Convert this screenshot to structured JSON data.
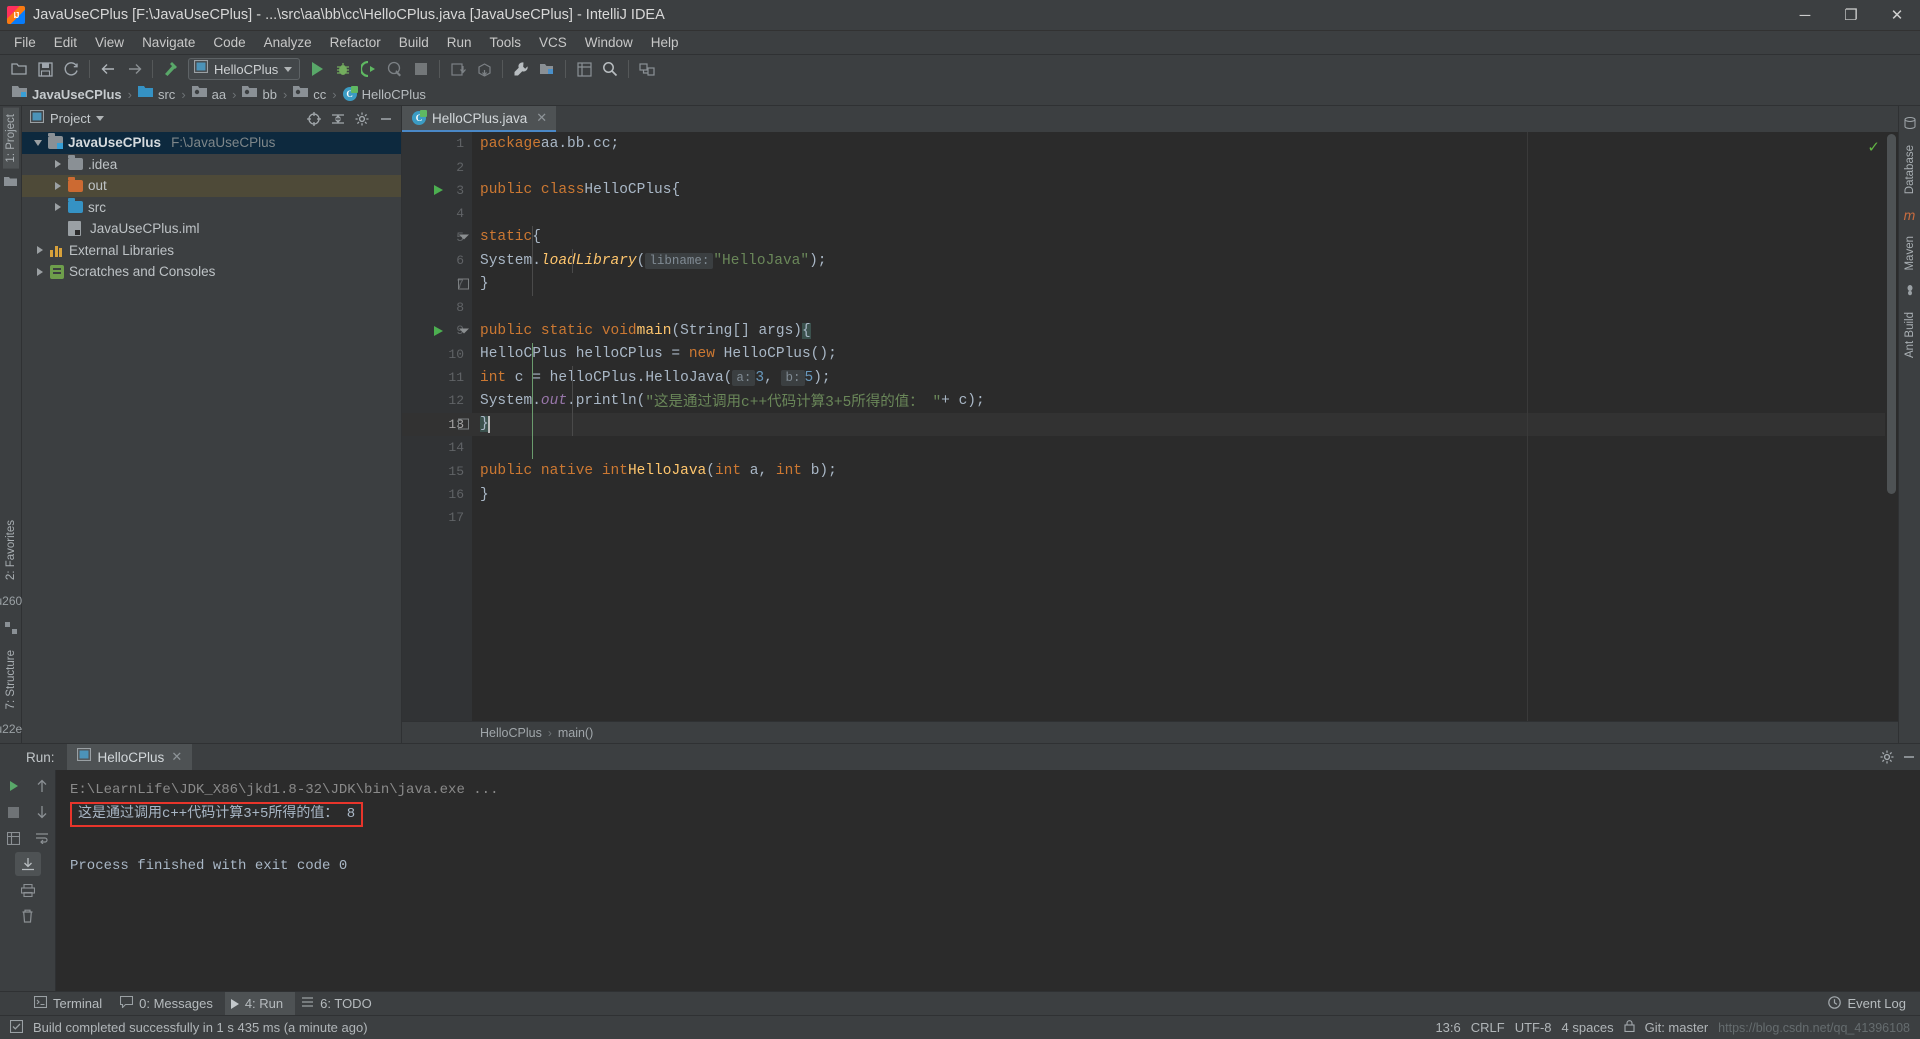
{
  "window": {
    "title": "JavaUseCPlus [F:\\JavaUseCPlus] - ...\\src\\aa\\bb\\cc\\HelloCPlus.java [JavaUseCPlus] - IntelliJ IDEA",
    "minimize_label": "─",
    "maximize_label": "❐",
    "close_label": "✕",
    "logo_icon": "intellij-idea-logo"
  },
  "menubar": {
    "items": [
      "File",
      "Edit",
      "View",
      "Navigate",
      "Code",
      "Analyze",
      "Refactor",
      "Build",
      "Run",
      "Tools",
      "VCS",
      "Window",
      "Help"
    ]
  },
  "toolbar": {
    "buttons": [
      {
        "name": "open-folder-icon",
        "glyph": "📂"
      },
      {
        "name": "save-all-icon",
        "glyph": "💾"
      },
      {
        "name": "sync-refresh-icon",
        "glyph": "↻"
      },
      {
        "name": "back-arrow-icon",
        "glyph": "←"
      },
      {
        "name": "forward-arrow-icon",
        "glyph": "→"
      },
      {
        "name": "compile-hammer-icon",
        "glyph": "⚒"
      }
    ],
    "run_config": {
      "label": "HelloCPlus",
      "icon": "run-configuration-icon"
    },
    "run_button": "run-icon",
    "debug_button": "debug-icon",
    "run_coverage_button": "run-with-coverage-icon",
    "profile_button": "profile-icon",
    "stop_button": "stop-icon",
    "right_buttons": [
      {
        "name": "update-project-icon",
        "glyph": "⭳"
      },
      {
        "name": "commit-icon",
        "glyph": "⭱"
      },
      {
        "name": "settings-wrench-icon",
        "glyph": "🔧"
      },
      {
        "name": "project-structure-icon",
        "glyph": "▣"
      },
      {
        "name": "sdk-manager-icon",
        "glyph": "▤"
      },
      {
        "name": "search-everywhere-icon",
        "glyph": "⚲"
      },
      {
        "name": "device-manager-icon",
        "glyph": "⌗"
      }
    ]
  },
  "breadcrumb": {
    "items": [
      {
        "label": "JavaUseCPlus",
        "icon": "project-module-icon"
      },
      {
        "label": "src",
        "icon": "source-folder-icon"
      },
      {
        "label": "aa",
        "icon": "package-icon"
      },
      {
        "label": "bb",
        "icon": "package-icon"
      },
      {
        "label": "cc",
        "icon": "package-icon"
      },
      {
        "label": "HelloCPlus",
        "icon": "java-class-icon"
      }
    ],
    "separator": "›"
  },
  "left_rail": {
    "tabs": [
      {
        "label": "1: Project",
        "active": true
      },
      {
        "label": "2: Favorites",
        "active": false
      },
      {
        "label": "7: Structure",
        "active": false
      }
    ],
    "icons": [
      "folder-icon",
      "bookmark-star-icon",
      "structure-icon"
    ]
  },
  "right_rail": {
    "tabs": [
      "Database",
      "Maven",
      "Ant Build"
    ]
  },
  "project_panel": {
    "title": "Project",
    "title_caret": "▾",
    "header_icons": [
      {
        "name": "scroll-from-source-icon",
        "glyph": "⊕"
      },
      {
        "name": "collapse-all-icon",
        "glyph": "⤓"
      },
      {
        "name": "settings-gear-icon",
        "glyph": "⚙"
      },
      {
        "name": "hide-panel-icon",
        "glyph": "─"
      }
    ],
    "tree": [
      {
        "label": "JavaUseCPlus",
        "path": "F:\\JavaUseCPlus",
        "icon": "project-module-icon",
        "indent": 0,
        "arrow": "open",
        "selected": true,
        "bold": true
      },
      {
        "label": ".idea",
        "path": "",
        "icon": "folder-grey-icon",
        "indent": 1,
        "arrow": "closed",
        "selected": false,
        "bold": false
      },
      {
        "label": "out",
        "path": "",
        "icon": "folder-orange-icon",
        "indent": 1,
        "arrow": "closed",
        "selected": false,
        "highlight": true,
        "bold": false
      },
      {
        "label": "src",
        "path": "",
        "icon": "source-folder-icon",
        "indent": 1,
        "arrow": "closed",
        "selected": false,
        "bold": false
      },
      {
        "label": "JavaUseCPlus.iml",
        "path": "",
        "icon": "iml-file-icon",
        "indent": 2,
        "arrow": "none",
        "selected": false,
        "bold": false
      },
      {
        "label": "External Libraries",
        "path": "",
        "icon": "external-libraries-icon",
        "indent": 0,
        "arrow": "closed",
        "selected": false,
        "bold": false
      },
      {
        "label": "Scratches and Consoles",
        "path": "",
        "icon": "scratches-icon",
        "indent": 0,
        "arrow": "closed",
        "selected": false,
        "bold": false
      }
    ]
  },
  "editor": {
    "tab": {
      "filename": "HelloCPlus.java",
      "icon": "java-class-icon",
      "close": "✕"
    },
    "inspection_status": "✓",
    "lines": [
      {
        "n": 1,
        "run_marker": false,
        "fold": "none"
      },
      {
        "n": 2,
        "run_marker": false,
        "fold": "none"
      },
      {
        "n": 3,
        "run_marker": true,
        "fold": "none"
      },
      {
        "n": 4,
        "run_marker": false,
        "fold": "none"
      },
      {
        "n": 5,
        "run_marker": false,
        "fold": "start"
      },
      {
        "n": 6,
        "run_marker": false,
        "fold": "none"
      },
      {
        "n": 7,
        "run_marker": false,
        "fold": "end"
      },
      {
        "n": 8,
        "run_marker": false,
        "fold": "none"
      },
      {
        "n": 9,
        "run_marker": true,
        "fold": "start"
      },
      {
        "n": 10,
        "run_marker": false,
        "fold": "none"
      },
      {
        "n": 11,
        "run_marker": false,
        "fold": "none"
      },
      {
        "n": 12,
        "run_marker": false,
        "fold": "none"
      },
      {
        "n": 13,
        "run_marker": false,
        "fold": "end",
        "current": true
      },
      {
        "n": 14,
        "run_marker": false,
        "fold": "none"
      },
      {
        "n": 15,
        "run_marker": false,
        "fold": "none"
      },
      {
        "n": 16,
        "run_marker": false,
        "fold": "none"
      },
      {
        "n": 17,
        "run_marker": false,
        "fold": "none"
      }
    ],
    "source_text": [
      "package aa.bb.cc;",
      "",
      "public class HelloCPlus {",
      "",
      "    static {",
      "        System.loadLibrary( libname: \"HelloJava\");",
      "    }",
      "",
      "    public static void main(String[] args){",
      "        HelloCPlus helloCPlus = new HelloCPlus();",
      "        int c = helloCPlus.HelloJava( a: 3,  b: 5);",
      "        System.out.println(\"这是通过调用c++代码计算3+5所得的值： \"+ c);",
      "    }",
      "",
      "    public native int HelloJava(int a, int b);",
      "}",
      ""
    ],
    "param_hints": [
      "libname:",
      "a:",
      "b:"
    ],
    "string_literals": [
      "\"HelloJava\"",
      "\"这是通过调用c++代码计算3+5所得的值： \""
    ],
    "breadcrumb_bottom": {
      "class": "HelloCPlus",
      "method": "main()",
      "separator": "›"
    }
  },
  "run_window": {
    "label": "Run:",
    "tab": {
      "name": "HelloCPlus",
      "icon": "run-configuration-icon",
      "close": "✕"
    },
    "header_icons": [
      {
        "name": "settings-gear-icon",
        "glyph": "⚙"
      },
      {
        "name": "hide-panel-icon",
        "glyph": "─"
      }
    ],
    "side_buttons": [
      {
        "name": "rerun-button",
        "glyph": "▶"
      },
      {
        "name": "scroll-up-button",
        "glyph": "↑"
      },
      {
        "name": "stop-button",
        "glyph": "■"
      },
      {
        "name": "scroll-down-button",
        "glyph": "↓"
      },
      {
        "name": "print-layout-button",
        "glyph": "▦"
      },
      {
        "name": "soft-wrap-button",
        "glyph": "↩"
      },
      {
        "name": "scroll-to-end-button",
        "glyph": "↧"
      },
      {
        "name": "print-button",
        "glyph": "🖨"
      },
      {
        "name": "clear-all-button",
        "glyph": "🗑"
      }
    ],
    "console": {
      "command_line": "E:\\LearnLife\\JDK_X86\\jkd1.8-32\\JDK\\bin\\java.exe ...",
      "program_output": "这是通过调用c++代码计算3+5所得的值： 8",
      "exit_message": "Process finished with exit code 0",
      "highlight_color": "#e8352b"
    }
  },
  "bottom_tabs": {
    "items": [
      {
        "label": "Terminal",
        "icon": "terminal-icon",
        "active": false
      },
      {
        "label": "0: Messages",
        "icon": "messages-icon",
        "active": false
      },
      {
        "label": "4: Run",
        "icon": "run-icon",
        "active": true
      },
      {
        "label": "6: TODO",
        "icon": "todo-icon",
        "active": false
      }
    ],
    "event_log": {
      "label": "Event Log",
      "icon": "event-log-icon"
    }
  },
  "status_bar": {
    "build_icon": "build-status-icon",
    "message": "Build completed successfully in 1 s 435 ms (a minute ago)",
    "caret_position": "13:6",
    "line_separator": "CRLF",
    "encoding": "UTF-8",
    "indent": "4 spaces",
    "branch": "Git: master",
    "watermark": "https://blog.csdn.net/qq_41396108",
    "lock_icon": "lock-icon"
  },
  "colors": {
    "background": "#3c3f41",
    "editor_bg": "#2b2b2b",
    "accent": "#4a88c7",
    "selection": "#0d293e",
    "keyword": "#cc7832",
    "string": "#6a8759",
    "number": "#6897bb",
    "method": "#ffc66d",
    "field": "#9876aa",
    "run_green": "#59a869",
    "highlight_red": "#e8352b",
    "folder_orange": "#cc6a32"
  }
}
